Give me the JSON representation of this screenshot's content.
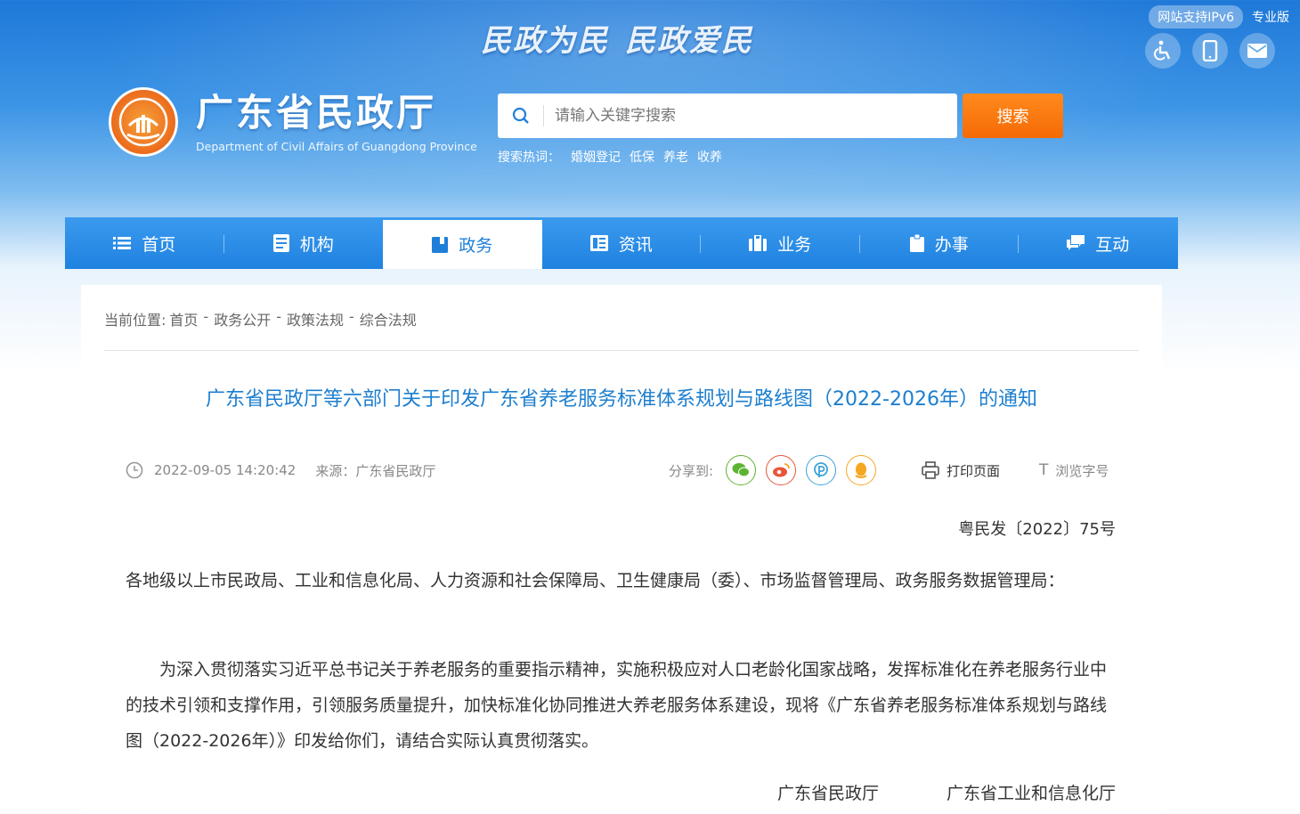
{
  "header": {
    "slogan": [
      "民政为民",
      "民政爱民"
    ],
    "ipv6_badge": "网站支持IPv6",
    "pro_link": "专业版",
    "logo_title": "广东省民政厅",
    "logo_subtitle": "Department of Civil Affairs of Guangdong Province",
    "search": {
      "placeholder": "请输入关键字搜索",
      "button_label": "搜索",
      "hot_label": "搜索热词：",
      "hot_words": [
        "婚姻登记",
        "低保",
        "养老",
        "收养"
      ]
    },
    "icons": [
      "accessibility-icon",
      "mobile-icon",
      "mail-icon"
    ]
  },
  "nav": {
    "items": [
      {
        "label": "首页",
        "icon": "list-icon",
        "active": false
      },
      {
        "label": "机构",
        "icon": "document-icon",
        "active": false
      },
      {
        "label": "政务",
        "icon": "book-icon",
        "active": true
      },
      {
        "label": "资讯",
        "icon": "news-icon",
        "active": false
      },
      {
        "label": "业务",
        "icon": "briefcase-icon",
        "active": false
      },
      {
        "label": "办事",
        "icon": "clipboard-icon",
        "active": false
      },
      {
        "label": "互动",
        "icon": "chat-icon",
        "active": false
      }
    ]
  },
  "breadcrumb": {
    "label": "当前位置:",
    "items": [
      "首页",
      "政务公开",
      "政策法规",
      "综合法规"
    ]
  },
  "article": {
    "title": "广东省民政厅等六部门关于印发广东省养老服务标准体系规划与路线图（2022-2026年）的通知",
    "date": "2022-09-05 14:20:42",
    "source": "来源：广东省民政厅",
    "share_label": "分享到:",
    "share_buttons": [
      {
        "name": "wechat-icon",
        "color": "#5cb531"
      },
      {
        "name": "weibo-icon",
        "color": "#e9543a"
      },
      {
        "name": "pengyou-icon",
        "color": "#3aa3d9"
      },
      {
        "name": "qq-icon",
        "color": "#f5a623"
      }
    ],
    "print_label": "打印页面",
    "font_label": "浏览字号",
    "doc_number": "粤民发〔2022〕75号",
    "recipients": "各地级以上市民政局、工业和信息化局、人力资源和社会保障局、卫生健康局（委）、市场监督管理局、政务服务数据管理局：",
    "body": "为深入贯彻落实习近平总书记关于养老服务的重要指示精神，实施积极应对人口老龄化国家战略，发挥标准化在养老服务行业中的技术引领和支撑作用，引领服务质量提升，加快标准化协同推进大养老服务体系建设，现将《广东省养老服务标准体系规划与路线图（2022-2026年）》印发给你们，请结合实际认真贯彻落实。",
    "signers": [
      "广东省民政厅",
      "广东省工业和信息化厅"
    ]
  }
}
